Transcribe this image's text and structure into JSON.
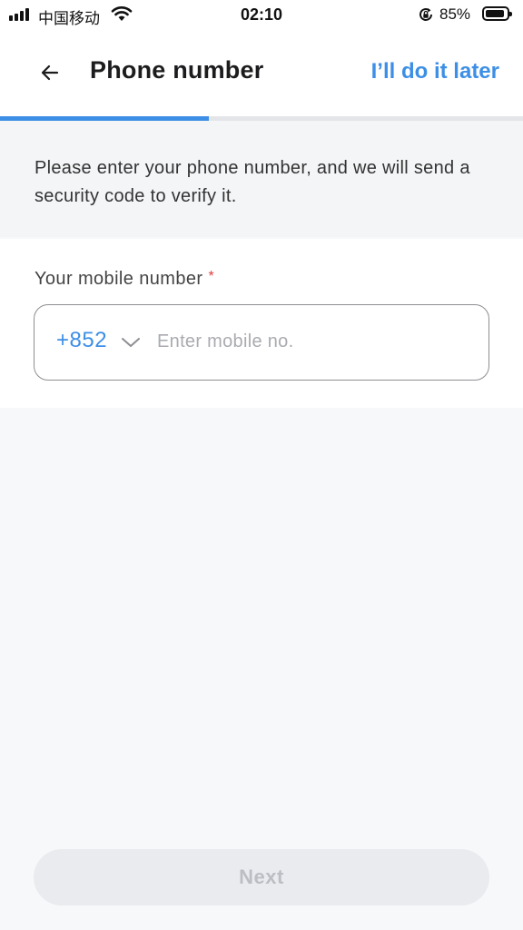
{
  "status_bar": {
    "carrier": "中国移动",
    "time": "02:10",
    "battery_percent": "85%",
    "signal_icon": "signal-bars-icon",
    "wifi_icon": "wifi-icon",
    "lock_icon": "rotation-lock-icon",
    "battery_icon": "battery-icon",
    "battery_level": 0.85
  },
  "header": {
    "title": "Phone number",
    "back_icon": "back-arrow-icon",
    "skip_label": "I’ll do it later"
  },
  "progress": {
    "fraction": 0.4
  },
  "intro": {
    "text": "Please enter your phone number, and we will send a security code to verify it."
  },
  "form": {
    "label": "Your mobile number",
    "required_mark": "*",
    "country_code": "+852",
    "country_code_icon": "chevron-down-icon",
    "mobile_value": "",
    "mobile_placeholder": "Enter mobile no."
  },
  "actions": {
    "next_label": "Next",
    "next_enabled": false
  },
  "colors": {
    "accent": "#3d8fe6",
    "required": "#e03c3c",
    "disabled_button_bg": "#e9ebef",
    "disabled_button_text": "#bcbec3"
  }
}
